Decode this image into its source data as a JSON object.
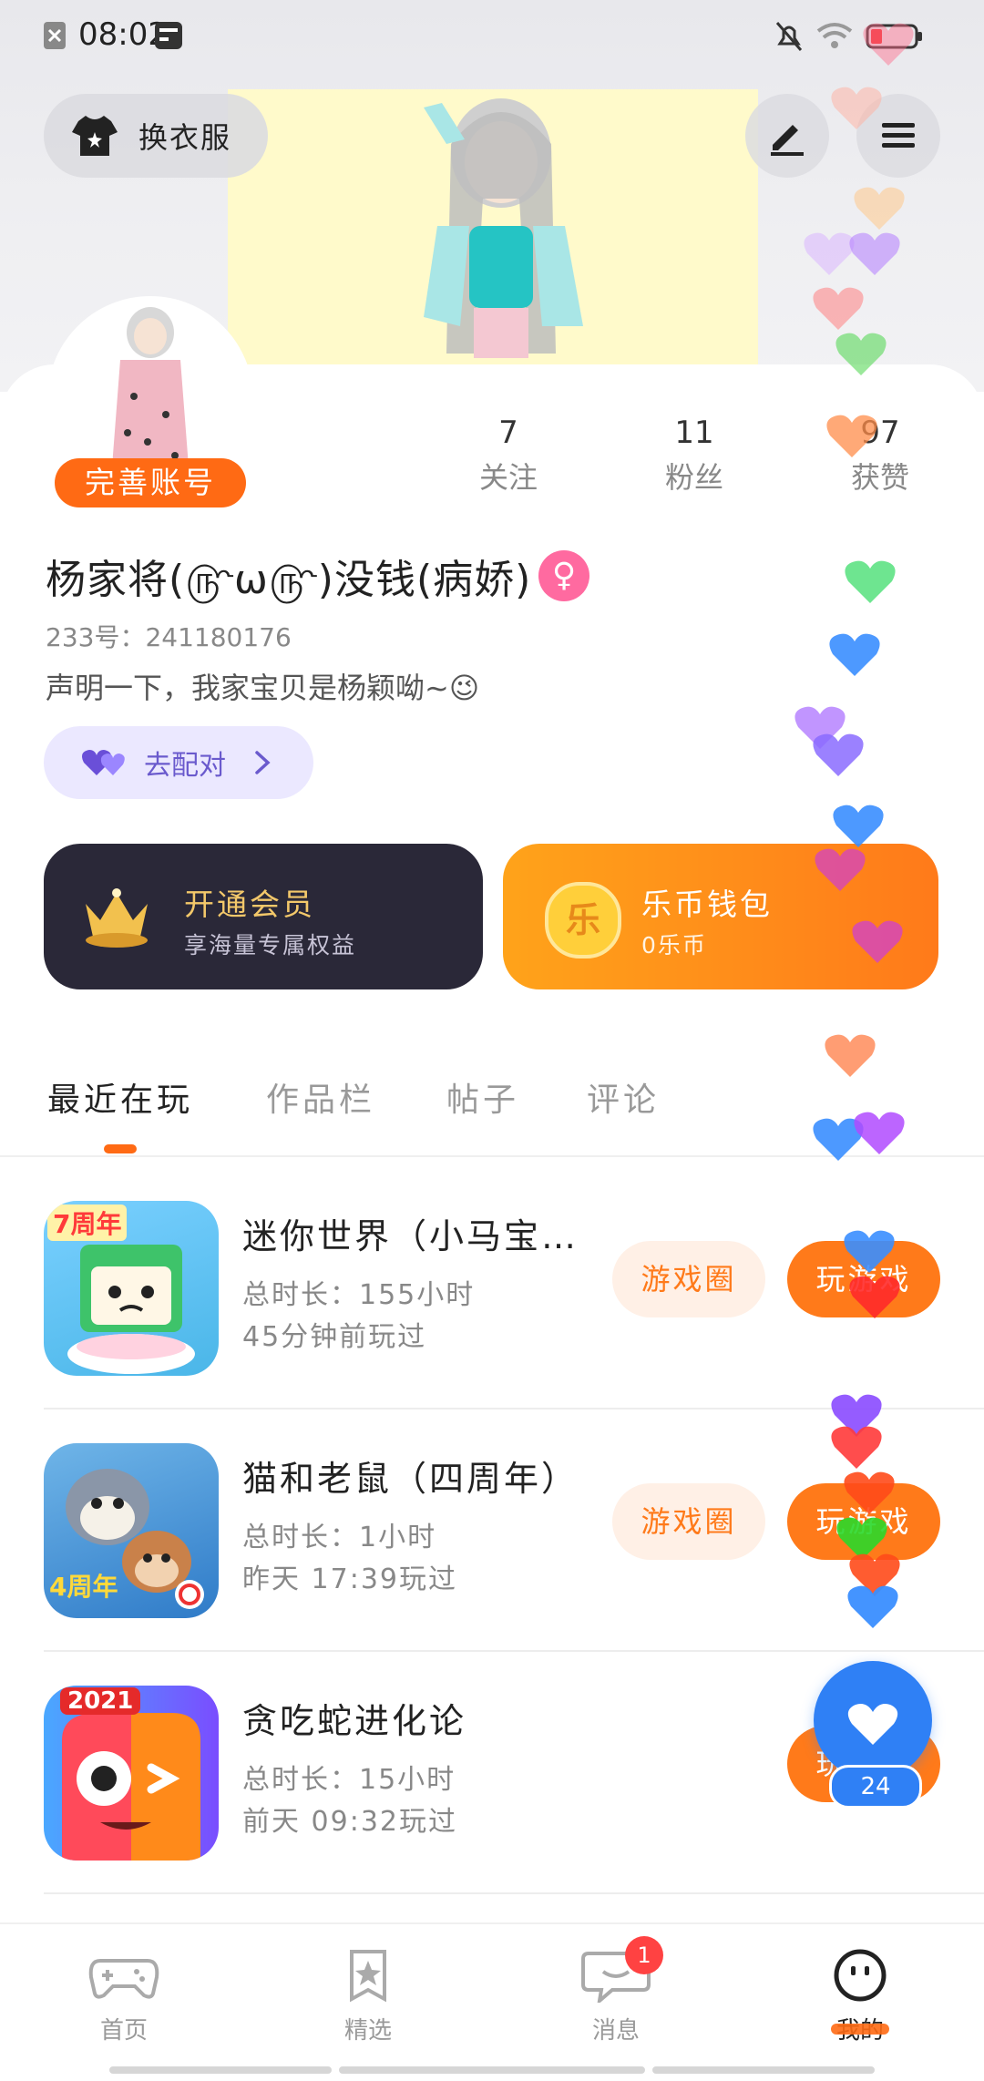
{
  "status_bar": {
    "time": "08:02"
  },
  "header": {
    "outfit_label": "换衣服"
  },
  "profile": {
    "complete_label": "完善账号",
    "stats": [
      {
        "num": "7",
        "label": "关注"
      },
      {
        "num": "11",
        "label": "粉丝"
      },
      {
        "num": "97",
        "label": "获赞"
      }
    ],
    "username": "杨家将(௹ω௹)没钱(病娇)",
    "gender": "♀",
    "uid": "233号：241180176",
    "bio": "声明一下，我家宝贝是杨颖呦~😉",
    "match_label": "去配对"
  },
  "cards": {
    "vip": {
      "title": "开通会员",
      "sub": "享海量专属权益"
    },
    "wallet": {
      "title": "乐币钱包",
      "sub": "0乐币",
      "coin": "乐"
    }
  },
  "tabs": [
    "最近在玩",
    "作品栏",
    "帖子",
    "评论"
  ],
  "games": [
    {
      "name": "迷你世界（小马宝…",
      "duration": "总时长：155小时",
      "last": "45分钟前玩过",
      "badge": "7周年"
    },
    {
      "name": "猫和老鼠（四周年）",
      "duration": "总时长：1小时",
      "last": "昨天 17:39玩过",
      "badge": "4周年"
    },
    {
      "name": "贪吃蛇进化论",
      "duration": "总时长：15小时",
      "last": "前天 09:32玩过",
      "badge": "2021"
    }
  ],
  "game_actions": {
    "circle": "游戏圈",
    "play": "玩游戏"
  },
  "like": {
    "count": "24"
  },
  "nav": [
    {
      "label": "首页",
      "icon": "gamepad-icon"
    },
    {
      "label": "精选",
      "icon": "star-icon"
    },
    {
      "label": "消息",
      "icon": "chat-icon",
      "badge": "1"
    },
    {
      "label": "我的",
      "icon": "face-icon"
    }
  ],
  "colors": {
    "accent": "#ff6a14",
    "wallet": "#ff8a1a",
    "vip_bg": "#2a2838",
    "like": "#2f80f5"
  }
}
